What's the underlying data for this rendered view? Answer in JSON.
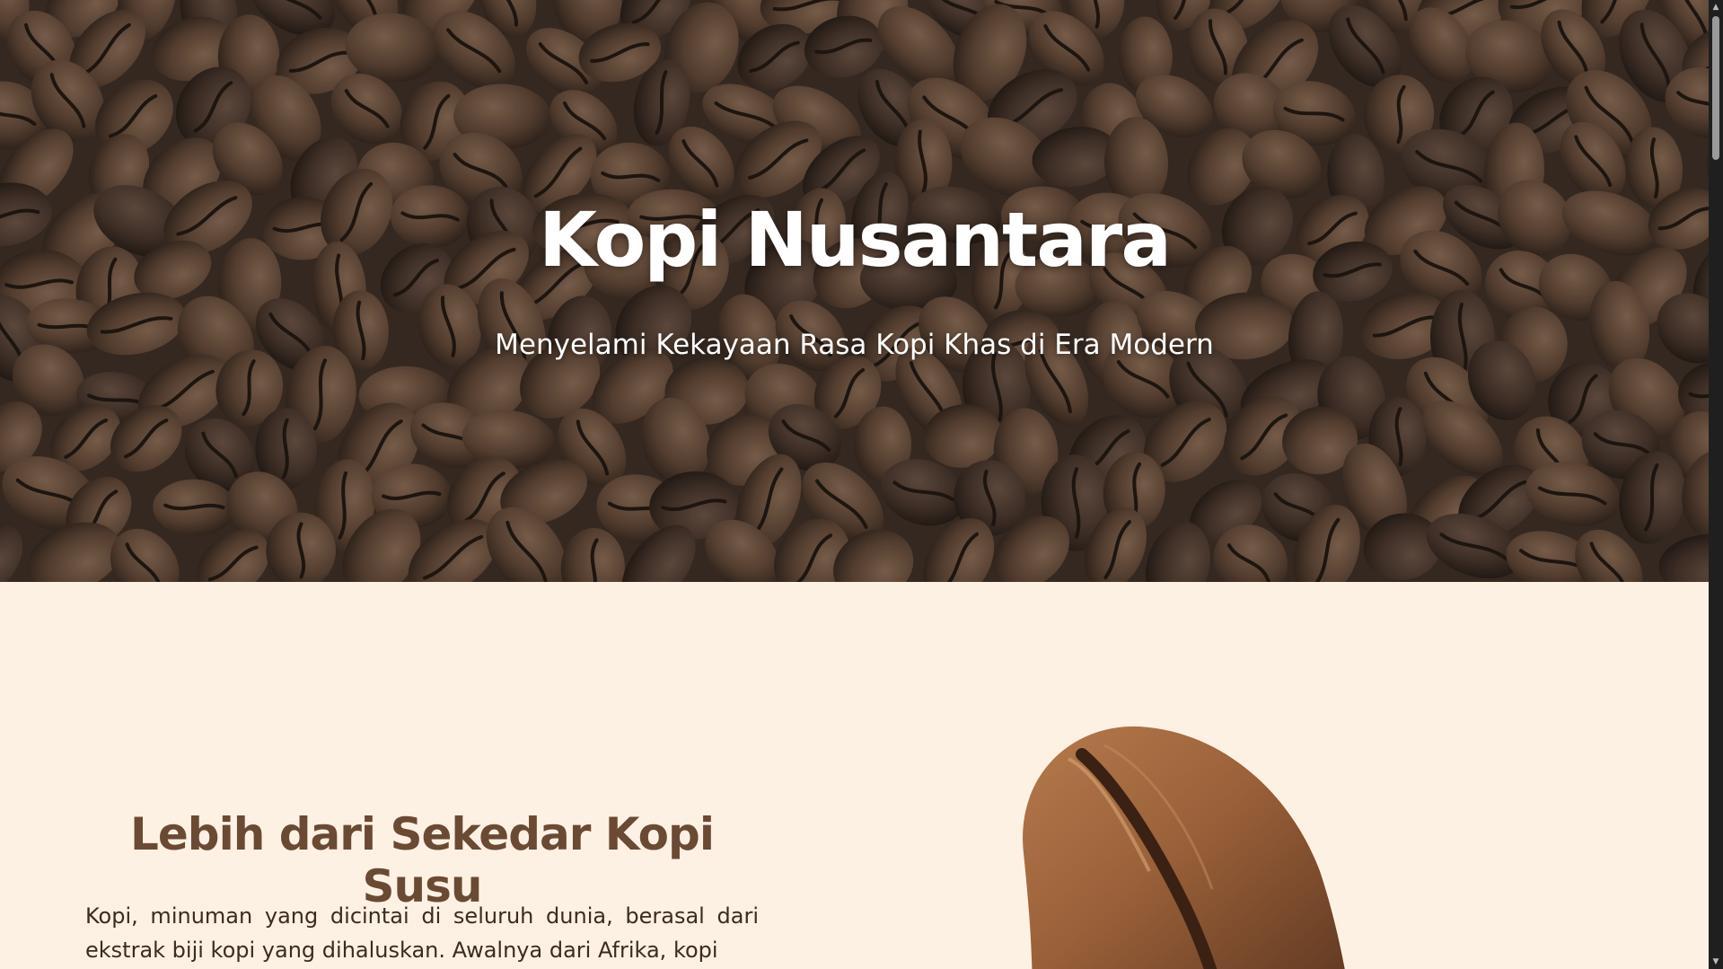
{
  "hero": {
    "title": "Kopi Nusantara",
    "subtitle": "Menyelami Kekayaan Rasa Kopi Khas di Era Modern",
    "background_image": "coffee-beans-background"
  },
  "about": {
    "heading": "Lebih dari Sekedar Kopi Susu",
    "paragraph": "Kopi, minuman yang dicintai di seluruh dunia, berasal dari ekstrak biji kopi yang dihaluskan. Awalnya dari Afrika, kopi",
    "image": "single-coffee-bean-image"
  },
  "scrollbar": {
    "up_icon": "chevron-up-icon",
    "down_icon": "chevron-down-icon"
  },
  "colors": {
    "background": "#fdf1e4",
    "heading": "#6b4a33",
    "body_text": "#3d2b20",
    "hero_text": "#ffffff"
  }
}
